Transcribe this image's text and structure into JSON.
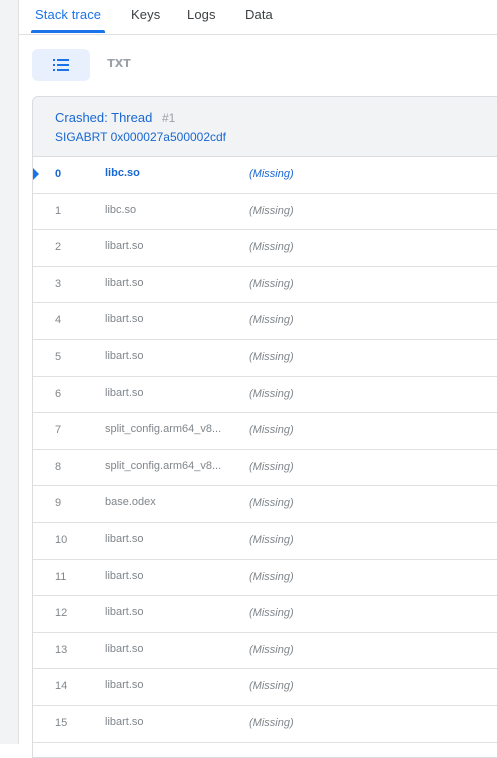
{
  "tabs": [
    {
      "label": "Stack trace",
      "active": true
    },
    {
      "label": "Keys",
      "active": false
    },
    {
      "label": "Logs",
      "active": false
    },
    {
      "label": "Data",
      "active": false
    }
  ],
  "view_toggle": {
    "list_icon": "list-icon",
    "txt_label": "TXT",
    "selected": "list"
  },
  "thread": {
    "title": "Crashed: Thread",
    "number": "#1",
    "signal": "SIGABRT 0x000027a500002cdf"
  },
  "frames": [
    {
      "index": "0",
      "library": "libc.so",
      "symbol": "(Missing)",
      "highlighted": true
    },
    {
      "index": "1",
      "library": "libc.so",
      "symbol": "(Missing)"
    },
    {
      "index": "2",
      "library": "libart.so",
      "symbol": "(Missing)"
    },
    {
      "index": "3",
      "library": "libart.so",
      "symbol": "(Missing)"
    },
    {
      "index": "4",
      "library": "libart.so",
      "symbol": "(Missing)"
    },
    {
      "index": "5",
      "library": "libart.so",
      "symbol": "(Missing)"
    },
    {
      "index": "6",
      "library": "libart.so",
      "symbol": "(Missing)"
    },
    {
      "index": "7",
      "library": "split_config.arm64_v8...",
      "symbol": "(Missing)"
    },
    {
      "index": "8",
      "library": "split_config.arm64_v8...",
      "symbol": "(Missing)"
    },
    {
      "index": "9",
      "library": "base.odex",
      "symbol": "(Missing)"
    },
    {
      "index": "10",
      "library": "libart.so",
      "symbol": "(Missing)"
    },
    {
      "index": "11",
      "library": "libart.so",
      "symbol": "(Missing)"
    },
    {
      "index": "12",
      "library": "libart.so",
      "symbol": "(Missing)"
    },
    {
      "index": "13",
      "library": "libart.so",
      "symbol": "(Missing)"
    },
    {
      "index": "14",
      "library": "libart.so",
      "symbol": "(Missing)"
    },
    {
      "index": "15",
      "library": "libart.so",
      "symbol": "(Missing)"
    }
  ],
  "colors": {
    "accent": "#1a73e8",
    "link": "#1967d2",
    "muted": "#80868b"
  }
}
